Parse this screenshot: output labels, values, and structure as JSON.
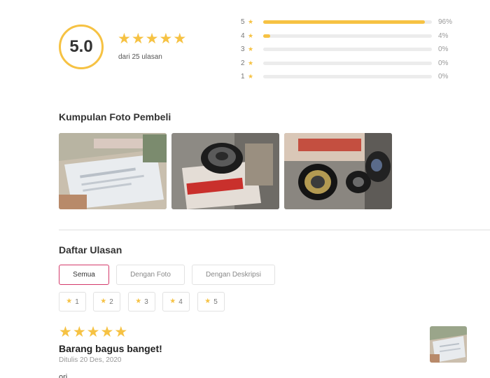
{
  "summary": {
    "score": "5.0",
    "stars": 5,
    "count_text": "dari 25 ulasan",
    "star_color": "#f6c243"
  },
  "distribution": [
    {
      "star": "5",
      "percent_label": "96%",
      "fraction": 0.96
    },
    {
      "star": "4",
      "percent_label": "4%",
      "fraction": 0.04
    },
    {
      "star": "3",
      "percent_label": "0%",
      "fraction": 0
    },
    {
      "star": "2",
      "percent_label": "0%",
      "fraction": 0
    },
    {
      "star": "1",
      "percent_label": "0%",
      "fraction": 0
    }
  ],
  "photos_section": {
    "title": "Kumpulan Foto Pembeli"
  },
  "reviews_section": {
    "title": "Daftar Ulasan",
    "filters": [
      "Semua",
      "Dengan Foto",
      "Dengan Deskripsi"
    ],
    "active_filter": "Semua",
    "active_color": "#d33a6a",
    "star_filters": [
      "1",
      "2",
      "3",
      "4",
      "5"
    ]
  },
  "review": {
    "stars": 5,
    "title": "Barang bagus banget!",
    "date": "Ditulis 20 Des, 2020",
    "body": "ori"
  }
}
